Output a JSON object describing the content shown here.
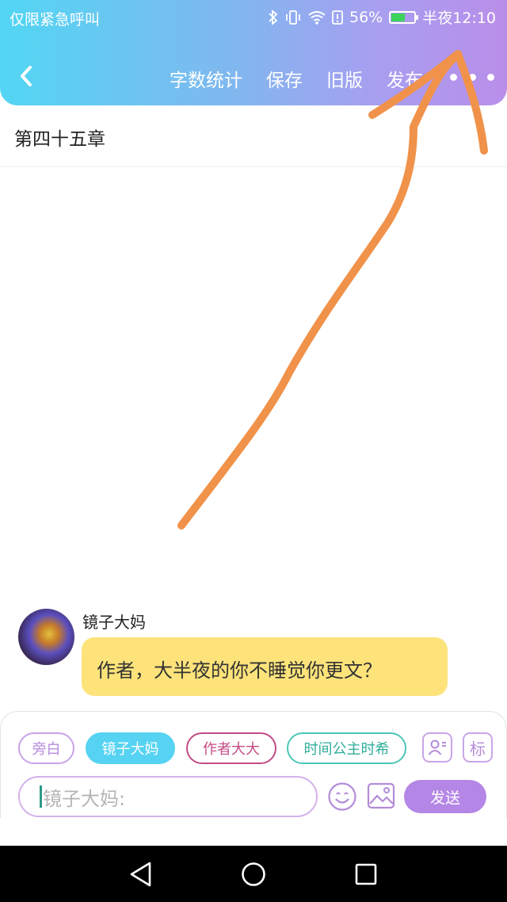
{
  "status_bar": {
    "carrier": "仅限紧急呼叫",
    "battery_percent": "56%",
    "battery_level": 0.56,
    "time": "半夜12:10",
    "icons": [
      "bluetooth-icon",
      "vibrate-icon",
      "wifi-icon",
      "alert-icon",
      "battery-icon"
    ]
  },
  "header": {
    "back_icon": "chevron-left-icon",
    "actions": [
      "字数统计",
      "保存",
      "旧版",
      "发布"
    ],
    "more_icon": "more-dots-icon"
  },
  "chapter": {
    "title": "第四十五章"
  },
  "message": {
    "sender": "镜子大妈",
    "text": "作者，大半夜的你不睡觉你更文？",
    "bubble_color": "#fde37a"
  },
  "composer": {
    "roles": [
      "旁白",
      "镜子大妈",
      "作者大大",
      "时间公主时希"
    ],
    "role_button_icon": "person-card-icon",
    "tag_button_label": "标",
    "input_placeholder": "镜子大妈:",
    "emoji_icon": "smiley-icon",
    "image_icon": "image-icon",
    "send_label": "发送",
    "accent_color": "#b486e6"
  },
  "system_nav": {
    "icons": [
      "back-triangle-icon",
      "home-circle-icon",
      "recents-square-icon"
    ]
  },
  "annotation": {
    "color": "#f0924a",
    "shape": "hand-drawn arrow pointing to the more menu"
  }
}
